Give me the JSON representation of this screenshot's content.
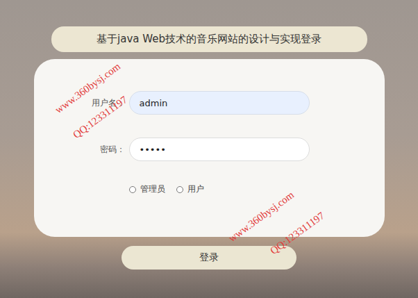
{
  "window": {
    "title": "基于java Web技术的音乐网站的设计与实现登录"
  },
  "form": {
    "fields": [
      {
        "label": "用户名：",
        "value": "admin",
        "autofilled": true
      },
      {
        "label": "密码：",
        "value": "•••••",
        "autofilled": false
      }
    ],
    "roles": [
      {
        "label": "管理员",
        "selected": false
      },
      {
        "label": "用户",
        "selected": false
      }
    ]
  },
  "buttons": [
    "登录"
  ],
  "watermarks": [
    "www.360bysj.com",
    "QQ:123311197",
    "www.360bysj.com",
    "QQ:123311197"
  ]
}
